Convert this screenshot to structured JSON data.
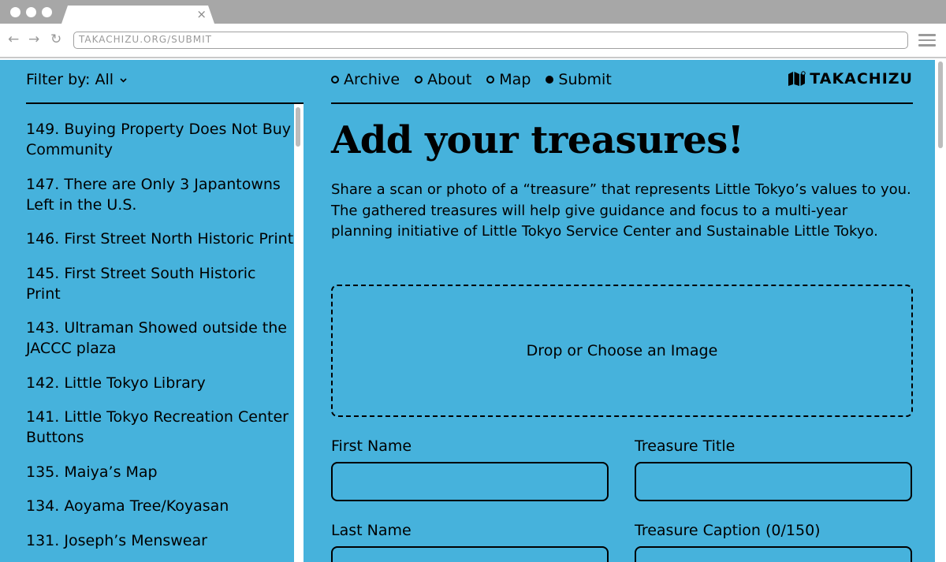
{
  "browser": {
    "url": "TAKACHIZU.ORG/SUBMIT",
    "tab_close": "×",
    "back_icon": "←",
    "forward_icon": "→",
    "reload_icon": "↻"
  },
  "sidebar": {
    "filter_label": "Filter by: All",
    "filter_chevron": "⌄",
    "items": [
      {
        "label": "149. Buying Property Does Not Buy Community"
      },
      {
        "label": "147. There are Only 3 Japantowns Left in the U.S."
      },
      {
        "label": "146. First Street North Historic Print"
      },
      {
        "label": "145. First Street South Historic Print"
      },
      {
        "label": "143. Ultraman Showed outside the JACCC plaza"
      },
      {
        "label": "142. Little Tokyo Library"
      },
      {
        "label": "141. Little Tokyo Recreation Center Buttons"
      },
      {
        "label": "135. Maiya’s Map"
      },
      {
        "label": "134. Aoyama Tree/Koyasan"
      },
      {
        "label": "131. Joseph’s Menswear"
      }
    ]
  },
  "nav": {
    "items": [
      {
        "label": "Archive",
        "active": false
      },
      {
        "label": "About",
        "active": false
      },
      {
        "label": "Map",
        "active": false
      },
      {
        "label": "Submit",
        "active": true
      }
    ]
  },
  "logo": {
    "text": "TAKACHIZU",
    "icon": "map-icon"
  },
  "main": {
    "title": "Add your treasures!",
    "intro": "Share a scan or photo of a “treasure” that represents Little Tokyo’s values to you. The gathered treasures will help give guidance and focus to a multi-year planning initiative of Little Tokyo Service Center and Sustainable Little Tokyo.",
    "dropzone_label": "Drop or Choose an Image"
  },
  "form": {
    "first_name_label": "First Name",
    "first_name_value": "",
    "treasure_title_label": "Treasure Title",
    "treasure_title_value": "",
    "last_name_label": "Last Name",
    "last_name_value": "",
    "treasure_caption_label": "Treasure Caption (0/150)",
    "treasure_caption_value": ""
  },
  "colors": {
    "page_background": "#46b2dc",
    "chrome_tabbar": "#a7a7a7",
    "text": "#000000"
  }
}
